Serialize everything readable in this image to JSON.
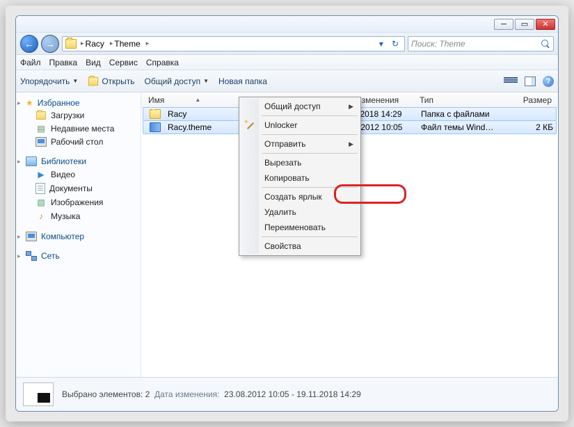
{
  "breadcrumb": {
    "items": [
      "Racy",
      "Theme"
    ]
  },
  "search": {
    "placeholder": "Поиск: Theme"
  },
  "menu": {
    "file": "Файл",
    "edit": "Правка",
    "view": "Вид",
    "tools": "Сервис",
    "help": "Справка"
  },
  "toolbar": {
    "organize": "Упорядочить",
    "open": "Открыть",
    "share": "Общий доступ",
    "newfolder": "Новая папка"
  },
  "nav": {
    "favorites": "Избранное",
    "downloads": "Загрузки",
    "recent": "Недавние места",
    "desktop": "Рабочий стол",
    "libraries": "Библиотеки",
    "videos": "Видео",
    "documents": "Документы",
    "pictures": "Изображения",
    "music": "Музыка",
    "computer": "Компьютер",
    "network": "Сеть"
  },
  "cols": {
    "name": "Имя",
    "date": "Дата изменения",
    "type": "Тип",
    "size": "Размер"
  },
  "rows": [
    {
      "name": "Racy",
      "date": "19.11.2018 14:29",
      "type": "Папка с файлами",
      "size": "",
      "icon": "folder"
    },
    {
      "name": "Racy.theme",
      "date": "23.08.2012 10:05",
      "type": "Файл темы Wind…",
      "size": "2 КБ",
      "icon": "theme"
    }
  ],
  "ctx": {
    "share": "Общий доступ",
    "unlocker": "Unlocker",
    "sendto": "Отправить",
    "cut": "Вырезать",
    "copy": "Копировать",
    "shortcut": "Создать ярлык",
    "delete": "Удалить",
    "rename": "Переименовать",
    "props": "Свойства"
  },
  "status": {
    "selected": "Выбрано элементов: 2",
    "date_label": "Дата изменения:",
    "date_value": "23.08.2012 10:05 - 19.11.2018 14:29"
  }
}
